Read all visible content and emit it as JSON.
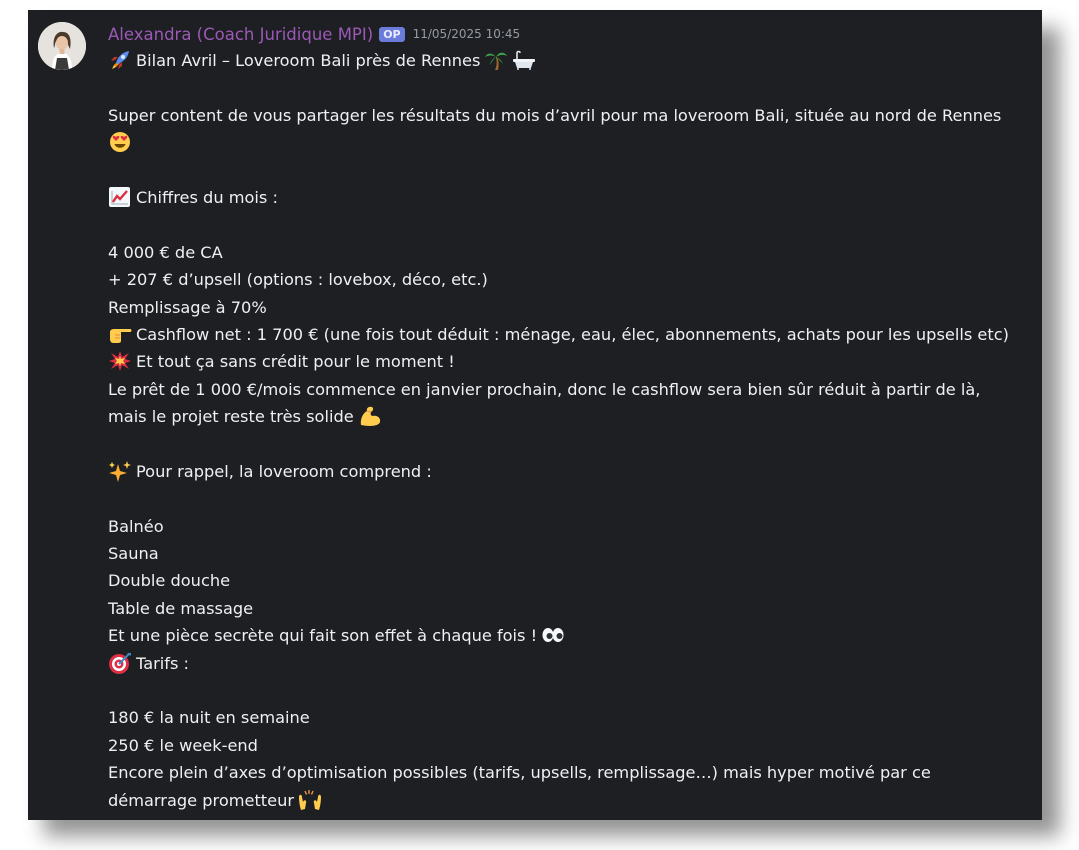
{
  "message": {
    "author": "Alexandra (Coach Juridique MPI)",
    "badge": "OP",
    "timestamp": "11/05/2025 10:45",
    "title": "Bilan Avril – Loveroom Bali près de Rennes",
    "intro": "Super content de vous partager les résultats du mois d’avril pour ma loveroom Bali, située au nord de Rennes",
    "figures_heading": "Chiffres du mois :",
    "revenue": "4 000 € de CA",
    "upsell": "+ 207 € d’upsell (options : lovebox, déco, etc.)",
    "occupancy": "Remplissage à 70%",
    "cashflow": "Cashflow net : 1 700 € (une fois tout déduit : ménage, eau, élec, abonnements, achats pour les upsells etc)",
    "no_credit": "Et tout ça sans crédit pour le moment !",
    "loan_line1": "Le prêt de 1 000 €/mois commence en janvier prochain, donc le cashflow sera bien sûr réduit à partir de là,",
    "loan_line2": "mais le projet reste très solide",
    "reminder_heading": "Pour rappel, la loveroom comprend :",
    "amenities": [
      "Balnéo",
      "Sauna",
      "Double douche",
      "Table de massage"
    ],
    "secret_room": "Et une pièce secrète qui fait son effet à chaque fois !",
    "pricing_heading": "Tarifs :",
    "price_weeknight": "180 € la nuit en semaine",
    "price_weekend": "250 € le week-end",
    "closing_line1": "Encore plein d’axes d’optimisation possibles (tarifs, upsells, remplissage…) mais hyper motivé par ce",
    "closing_line2": "démarrage prometteur"
  },
  "icons": {
    "title_lead": "rocket-icon",
    "title_trail": [
      "palm-tree-icon",
      "bathtub-icon"
    ],
    "intro_trail": "heart-eyes-icon",
    "figures": "chart-increasing-icon",
    "cashflow": "pointing-right-icon",
    "no_credit": "collision-icon",
    "loan": "flexed-biceps-icon",
    "reminder": "sparkles-icon",
    "secret": "eyes-icon",
    "pricing": "target-icon",
    "closing": "raising-hands-icon"
  },
  "colors": {
    "background": "#1e1f22",
    "author": "#9b59b6",
    "badge": "#6b7bd9",
    "timestamp": "#949ba4",
    "text": "#eef0f2"
  }
}
